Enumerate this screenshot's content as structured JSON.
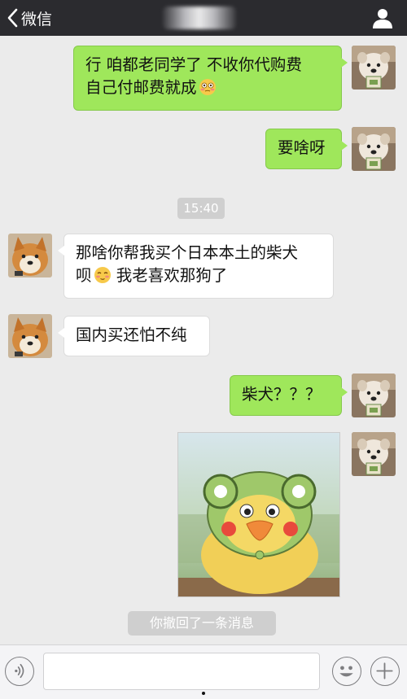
{
  "navbar": {
    "back_label": "微信",
    "title": ""
  },
  "messages": {
    "m1": {
      "line1": "行 咱都老同学了 不收你代购费",
      "line2": "自己付邮费就成"
    },
    "m2": {
      "text": "要啥呀"
    },
    "timestamp": "15:40",
    "m3": {
      "line1": "那啥你帮我买个日本本土的柴犬",
      "line2_a": "呗",
      "line2_b": " 我老喜欢那狗了"
    },
    "m4": {
      "text": "国内买还怕不纯"
    },
    "m5": {
      "text": "柴犬？？？"
    },
    "recall_notice": "你撤回了一条消息"
  },
  "input": {
    "placeholder": ""
  },
  "colors": {
    "navbar": "#2b2b2f",
    "chat_background": "#ebebeb",
    "outgoing_bubble": "#9fe75b",
    "incoming_bubble": "#ffffff",
    "system_label": "#cfcfcf"
  },
  "icons": {
    "back": "chevron-left-icon",
    "profile": "person-icon",
    "voice": "voice-icon",
    "emoji": "smiley-face-icon",
    "plus": "plus-icon"
  }
}
